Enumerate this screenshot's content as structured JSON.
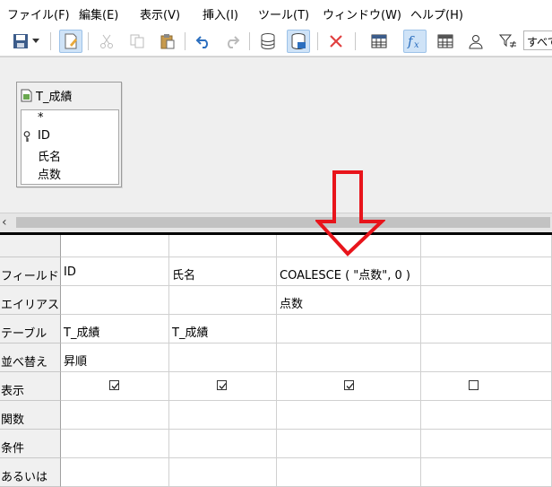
{
  "menu": [
    "ファイル(F)",
    "編集(E)",
    "表示(V)",
    "挿入(I)",
    "ツール(T)",
    "ウィンドウ(W)",
    "ヘルプ(H)"
  ],
  "toolbar": {
    "icons": [
      "save-icon",
      "dropdown-arrow-icon",
      "edit-design-icon",
      "cut-icon",
      "copy-icon",
      "paste-icon",
      "undo-icon",
      "redo-icon",
      "run-query-icon",
      "clear-query-icon",
      "delete-icon",
      "table-icon",
      "function-icon",
      "table-name-icon",
      "alias-icon",
      "distinct-icon"
    ],
    "limit_value": "すべて"
  },
  "table_window": {
    "title": "T_成績",
    "fields": [
      "*",
      "ID",
      "氏名",
      "点数"
    ]
  },
  "grid": {
    "row_labels": [
      "フィールド",
      "エイリアス",
      "テーブル",
      "並べ替え",
      "表示",
      "関数",
      "条件",
      "あるいは"
    ],
    "columns": [
      {
        "field": "ID",
        "alias": "",
        "table": "T_成績",
        "sort": "昇順",
        "visible": true
      },
      {
        "field": "氏名",
        "alias": "",
        "table": "T_成績",
        "sort": "",
        "visible": true
      },
      {
        "field": "COALESCE ( \"点数\", 0 )",
        "alias": "点数",
        "table": "",
        "sort": "",
        "visible": true
      },
      {
        "field": "",
        "alias": "",
        "table": "",
        "sort": "",
        "visible": false
      }
    ]
  },
  "annotation": {
    "arrow_color": "#e8141b"
  }
}
